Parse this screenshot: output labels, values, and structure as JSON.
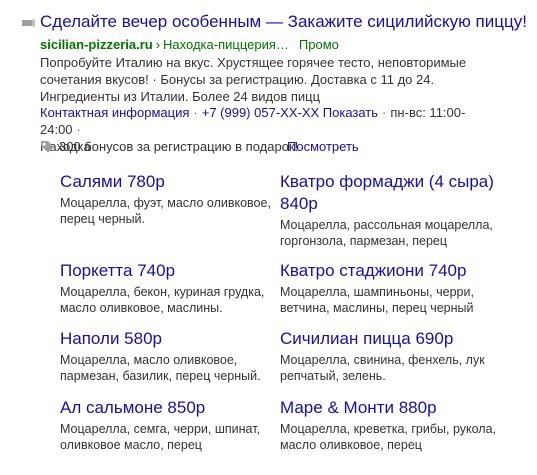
{
  "ad": {
    "title": "Сделайте вечер особенным — Закажите сицилийскую пиццу!",
    "domain": "sicilian-pizzeria.ru",
    "breadcrumb_sep": "›",
    "breadcrumb": "Находка-пиццерия…",
    "promo": "Промо",
    "description": "Попробуйте Италию на вкус. Хрустящее горячее тесто, неповторимые сочетания вкусов! · Бонусы за регистрацию. Доставка с 11 до 24. Ингредиенты из Италии. Более 24 видов пицц",
    "contacts": {
      "contact_link": "Контактная информация",
      "phone": "+7 (999) 057-XX-XX Показать",
      "hours": "пн-вс: 11:00-24:00",
      "city": "Находка",
      "dot": "·"
    },
    "bonus": {
      "text": "300 бонусов за регистрацию в подарок!",
      "link": "Посмотреть"
    }
  },
  "menu": [
    {
      "name": "Салями 780р",
      "desc": "Моцарелла, фуэт, масло оливковое, перец черный."
    },
    {
      "name": "Кватро формаджи (4 сыра) 840р",
      "desc": "Моцарелла, рассольная моцарелла, горгонзола, пармезан, перец"
    },
    {
      "name": "Поркетта 740р",
      "desc": "Моцарелла, бекон, куриная грудка, масло оливковое, маслины."
    },
    {
      "name": "Кватро стаджиони 740р",
      "desc": "Моцарелла, шампиньоны, черри, ветчина, маслины, перец черный"
    },
    {
      "name": "Наполи 580р",
      "desc": "Моцарелла, масло оливковое, пармезан, базилик, перец черный."
    },
    {
      "name": "Сичилиан пицца 690р",
      "desc": "Моцарелла, свинина, фенхель, лук репчатый, зелень."
    },
    {
      "name": "Ал сальмоне 850р",
      "desc": "Моцарелла, семга, черри, шпинат, оливковое масло, перец"
    },
    {
      "name": "Маре & Монти 880р",
      "desc": "Моцарелла, креветка, грибы, рукола, масло оливковое, перец"
    }
  ]
}
